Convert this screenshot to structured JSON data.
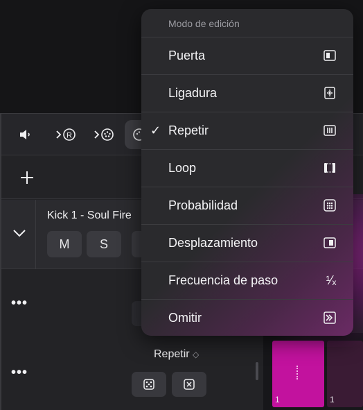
{
  "toolbar": {
    "icons": [
      "speaker-icon",
      "midi-input-icon",
      "midi-output-icon",
      "note-repeat-icon"
    ]
  },
  "track": {
    "name": "Kick 1 - Soul Fire",
    "mute_label": "M",
    "solo_label": "S"
  },
  "step_row": {
    "more_label": "•••",
    "mode_label": "Repetir",
    "mode_chevron": "◇"
  },
  "steps": [
    {
      "number": "1",
      "color": "#c2129e"
    },
    {
      "number": "1",
      "color": "#3a1b34"
    }
  ],
  "menu": {
    "header": "Modo de edición",
    "check_glyph": "✓",
    "items": [
      {
        "label": "Puerta",
        "icon": "gate-icon",
        "checked": false
      },
      {
        "label": "Ligadura",
        "icon": "tie-icon",
        "checked": false
      },
      {
        "label": "Repetir",
        "icon": "repeat-icon",
        "checked": true
      },
      {
        "label": "Loop",
        "icon": "loop-icon",
        "checked": false
      },
      {
        "label": "Probabilidad",
        "icon": "probability-icon",
        "checked": false
      },
      {
        "label": "Desplazamiento",
        "icon": "offset-icon",
        "checked": false
      },
      {
        "label": "Frecuencia de paso",
        "icon": "step-rate-icon",
        "checked": false
      },
      {
        "label": "Omitir",
        "icon": "skip-icon",
        "checked": false
      }
    ],
    "step_rate_glyph": "¹⁄ₓ"
  },
  "colors": {
    "accent_pink": "#c2129e",
    "menu_bg": "#2a2a2d",
    "panel_bg": "#232326"
  }
}
